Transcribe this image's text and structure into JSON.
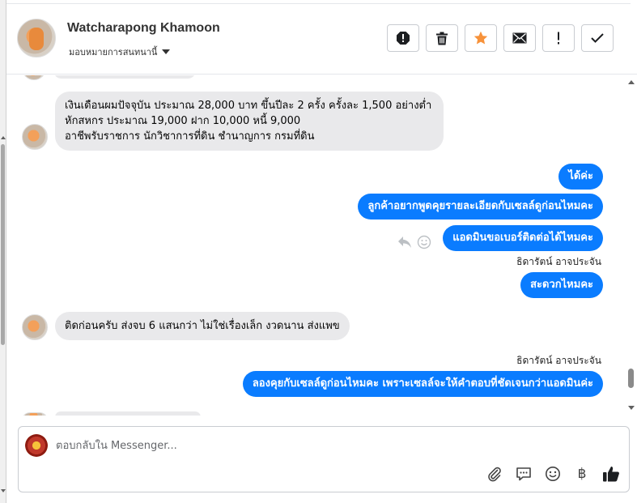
{
  "header": {
    "contact_name": "Watcharapong Khamoon",
    "assign_label": "มอบหมายการสนทนานี้",
    "actions": [
      {
        "icon": "alert-octagon-icon"
      },
      {
        "icon": "trash-icon"
      },
      {
        "icon": "star-icon",
        "color": "#f7923a"
      },
      {
        "icon": "envelope-icon"
      },
      {
        "icon": "exclamation-icon"
      },
      {
        "icon": "checkmark-icon"
      }
    ]
  },
  "messages": {
    "incoming_1": {
      "line1": "เงินเดือนผมปัจจุบัน ประมาณ 28,000 บาท ขึ้นปีละ 2 ครั้ง ครั้งละ 1,500 อย่างต่ำ",
      "line2": "หักสหกร ประมาณ 19,000 ฝาก 10,000 หนี้ 9,000",
      "line3": "อาชีพรับราชการ นักวิชาการที่ดิน ชำนาญการ กรมที่ดิน"
    },
    "outgoing_1": "ได้ค่ะ",
    "outgoing_2": "ลูกค้าอยากพูดคุยรายละเอียดกับเซลล์ดูก่อนไหมคะ",
    "outgoing_3": "แอดมินขอเบอร์ติดต่อได้ไหมคะ",
    "sender_1": "ธิดารัตน์ อาจประจัน",
    "outgoing_4": "สะดวกไหมคะ",
    "incoming_2": "ติดก่อนครับ ส่งจบ 6 แสนกว่า ไม่ใช่เรื่องเล็ก งวดนาน ส่งแพข",
    "sender_2": "ธิดารัตน์ อาจประจัน",
    "outgoing_5": "ลองคุยกับเซลล์ดูก่อนไหมคะ เพราะเซลล์จะให้คำตอบที่ชัดเจนกว่าแอดมินค่ะ"
  },
  "composer": {
    "placeholder": "ตอบกลับใน Messenger...",
    "tools": [
      "paperclip-icon",
      "chat-bubble-icon",
      "smiley-icon",
      "baht-icon",
      "thumbs-up-icon"
    ],
    "baht_symbol": "฿"
  },
  "colors": {
    "outgoing_bubble": "#0a7cff",
    "incoming_bubble": "#e9e9eb"
  }
}
